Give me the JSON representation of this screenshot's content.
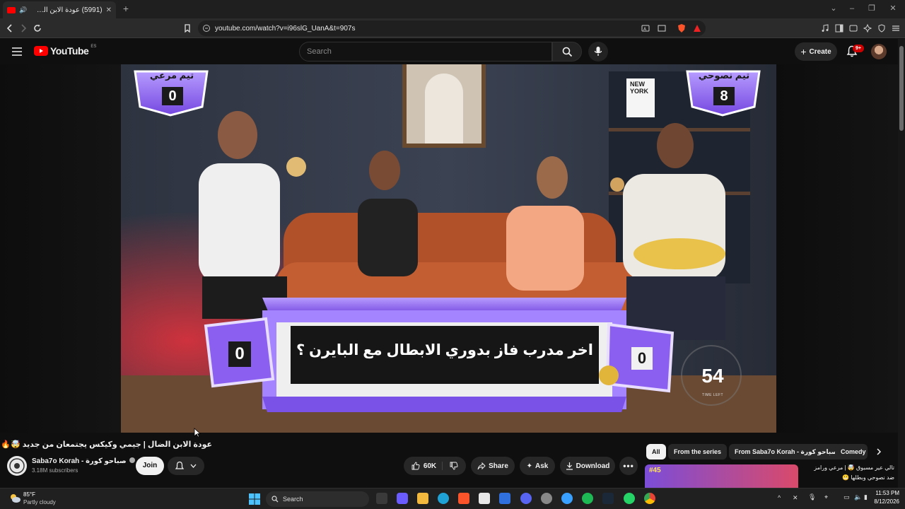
{
  "browser": {
    "tab_title": "(5991) عودة الابن الضال | جيم...",
    "url": "youtube.com/watch?v=i96slG_UanA&t=907s"
  },
  "header": {
    "logo_text": "YouTube",
    "country_code": "ES",
    "search_placeholder": "Search",
    "create_label": "Create",
    "notifications_count": "9+"
  },
  "video": {
    "team_left_name": "تيم مرعي",
    "team_left_score": "0",
    "team_right_name": "تيم نصوحي",
    "team_right_score": "8",
    "question_text": "اخر مدرب فاز بدوري الابطال مع البايرن ؟",
    "left_box_score": "0",
    "right_box_score": "0",
    "timer_value": "54",
    "timer_label": "TIME LEFT",
    "shelf_sign": "NEW YORK"
  },
  "watch": {
    "title": "عودة الابن الضال | جيمي وكيكس يجتمعان من جديد 🤯🔥🔥",
    "channel_name": "Saba7o Korah - صباحو كورة",
    "subscribers": "3.18M subscribers",
    "join_label": "Join",
    "likes": "60K",
    "share_label": "Share",
    "ask_label": "Ask",
    "download_label": "Download"
  },
  "chips": [
    "All",
    "From the series",
    "From Saba7o Korah - صباحو كورة",
    "Comedy"
  ],
  "recommendation": {
    "title": "تالي عير مسبوق 🤯 | مرعي ورامز",
    "subtitle": "ضد نصوحي وبطلها 😬",
    "thumb_badge": "#45"
  },
  "taskbar": {
    "weather_temp": "85°F",
    "weather_desc": "Partly cloudy",
    "search_label": "Search",
    "time": "11:53 PM",
    "date": "8/12/2026"
  },
  "colors": {
    "youtube_red": "#ff0000",
    "quiz_purple": "#8a5cf0",
    "quiz_dark": "#1a1a1a"
  }
}
